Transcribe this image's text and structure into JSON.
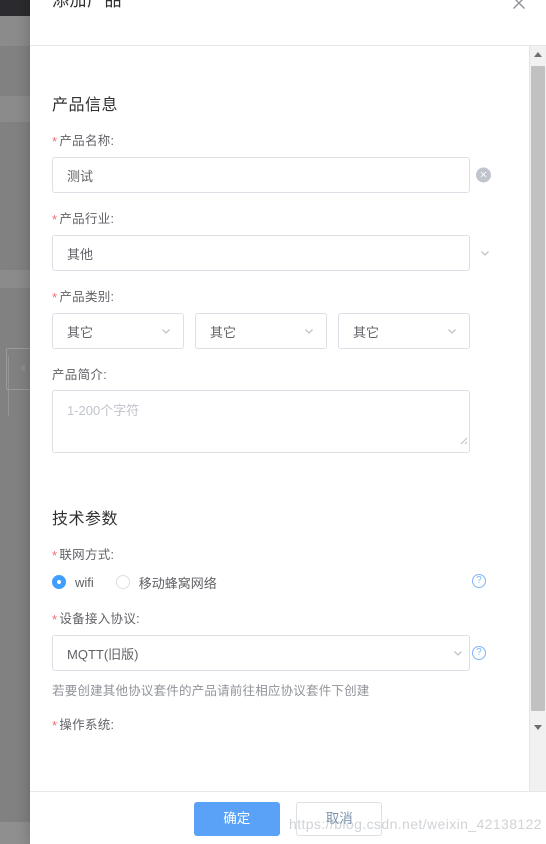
{
  "modal": {
    "title": "添加产品",
    "close_icon": "close-icon"
  },
  "sections": {
    "product_info": {
      "title": "产品信息",
      "name": {
        "label": "产品名称:",
        "required_mark": "*",
        "value": "测试",
        "clear_icon": "×"
      },
      "industry": {
        "label": "产品行业:",
        "required_mark": "*",
        "value": "其他"
      },
      "category": {
        "label": "产品类别:",
        "required_mark": "*",
        "value1": "其它",
        "value2": "其它",
        "value3": "其它"
      },
      "description": {
        "label": "产品简介:",
        "placeholder": "1-200个字符",
        "value": ""
      }
    },
    "tech_params": {
      "title": "技术参数",
      "network": {
        "label": "联网方式:",
        "required_mark": "*",
        "option1": "wifi",
        "option2": "移动蜂窝网络",
        "selected": "wifi",
        "help_icon": "?"
      },
      "protocol": {
        "label": "设备接入协议:",
        "required_mark": "*",
        "value": "MQTT(旧版)",
        "hint": "若要创建其他协议套件的产品请前往相应协议套件下创建",
        "help_icon": "?"
      },
      "os": {
        "label": "操作系统:",
        "required_mark": "*"
      }
    }
  },
  "footer": {
    "confirm_label": "确定",
    "cancel_label": "取消"
  },
  "watermark": {
    "text": "https://blog.csdn.net/weixin_42138122"
  },
  "colors": {
    "primary": "#409eff",
    "button_primary": "#5aa2f7",
    "required": "#f56c6c",
    "border": "#dcdfe6",
    "text": "#606266",
    "heading": "#303133",
    "placeholder": "#c0c4cc",
    "hint": "#909399",
    "scrollbar_thumb": "#c1c1c1"
  }
}
